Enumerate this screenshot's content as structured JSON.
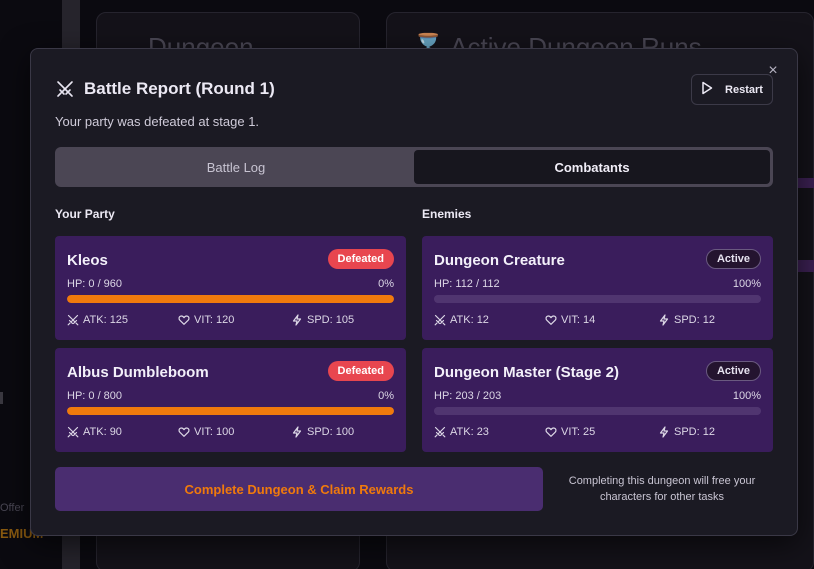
{
  "background": {
    "left_title": "Dungeon",
    "right_title": "Active Dungeon Runs",
    "premium_label": "EMIUM",
    "offer_label": "Offer"
  },
  "modal": {
    "title": "Battle Report (Round 1)",
    "subtitle": "Your party was defeated at stage 1.",
    "restart_label": "Restart",
    "close_glyph": "×",
    "tabs": [
      {
        "label": "Battle Log",
        "active": false
      },
      {
        "label": "Combatants",
        "active": true
      }
    ],
    "party_label": "Your Party",
    "enemies_label": "Enemies",
    "party": [
      {
        "name": "Kleos",
        "status": "Defeated",
        "hp": "HP: 0 / 960",
        "hp_pct": "0%",
        "fill": 1.0,
        "atk": "ATK: 125",
        "vit": "VIT: 120",
        "spd": "SPD: 105"
      },
      {
        "name": "Albus Dumbleboom",
        "status": "Defeated",
        "hp": "HP: 0 / 800",
        "hp_pct": "0%",
        "fill": 1.0,
        "atk": "ATK: 90",
        "vit": "VIT: 100",
        "spd": "SPD: 100"
      }
    ],
    "enemies": [
      {
        "name": "Dungeon Creature",
        "status": "Active",
        "hp": "HP: 112 / 112",
        "hp_pct": "100%",
        "fill": 1.0,
        "atk": "ATK: 12",
        "vit": "VIT: 14",
        "spd": "SPD: 12"
      },
      {
        "name": "Dungeon Master (Stage 2)",
        "status": "Active",
        "hp": "HP: 203 / 203",
        "hp_pct": "100%",
        "fill": 1.0,
        "atk": "ATK: 23",
        "vit": "VIT: 25",
        "spd": "SPD: 12"
      }
    ],
    "claim_label": "Complete Dungeon & Claim Rewards",
    "claim_note": "Completing this dungeon will free your characters for other tasks"
  },
  "colors": {
    "accent_orange": "#f07a0c",
    "card_purple": "#3a1d5c",
    "defeated_red": "#e8464f"
  },
  "icons": {
    "title": "crossed-swords-icon",
    "restart": "play-icon",
    "close": "close-icon",
    "atk": "crossed-swords-icon",
    "vit": "heart-icon",
    "spd": "lightning-icon"
  }
}
